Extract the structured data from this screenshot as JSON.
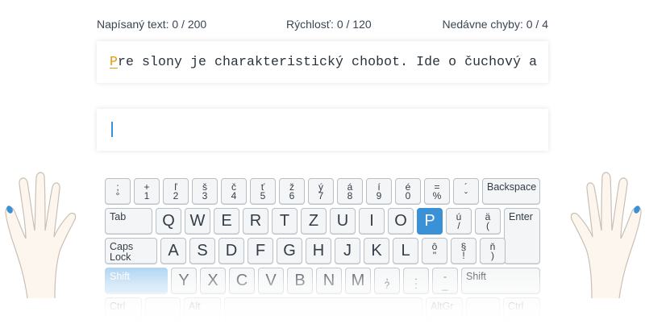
{
  "stats": {
    "typed_text": "Napísaný text: 0 / 200",
    "speed": "Rýchlosť: 0 / 120",
    "recent_errors": "Nedávne chyby: 0 / 4"
  },
  "lesson": {
    "current_char": "P",
    "remaining_text": "re slony je charakteristický chobot. Ide o čuchový a"
  },
  "input": {
    "value": ""
  },
  "keyboard": {
    "row1": [
      {
        "top": ";",
        "bottom": "°"
      },
      {
        "top": "+",
        "bottom": "1"
      },
      {
        "top": "ľ",
        "bottom": "2"
      },
      {
        "top": "š",
        "bottom": "3"
      },
      {
        "top": "č",
        "bottom": "4"
      },
      {
        "top": "ť",
        "bottom": "5"
      },
      {
        "top": "ž",
        "bottom": "6"
      },
      {
        "top": "ý",
        "bottom": "7"
      },
      {
        "top": "á",
        "bottom": "8"
      },
      {
        "top": "í",
        "bottom": "9"
      },
      {
        "top": "é",
        "bottom": "0"
      },
      {
        "top": "=",
        "bottom": "%"
      },
      {
        "top": "´",
        "bottom": "ˇ"
      }
    ],
    "backspace": "Backspace",
    "tab": "Tab",
    "row2_letters": [
      "Q",
      "W",
      "E",
      "R",
      "T",
      "Z",
      "U",
      "I",
      "O",
      "P"
    ],
    "row2_symbols": [
      {
        "top": "ú",
        "bottom": "/"
      },
      {
        "top": "ä",
        "bottom": "("
      }
    ],
    "enter": "Enter",
    "caps_lock": "Caps Lock",
    "row3_letters": [
      "A",
      "S",
      "D",
      "F",
      "G",
      "H",
      "J",
      "K",
      "L"
    ],
    "row3_symbols": [
      {
        "top": "ô",
        "bottom": "\""
      },
      {
        "top": "§",
        "bottom": "!"
      },
      {
        "top": "ň",
        "bottom": ")"
      }
    ],
    "shift": "Shift",
    "row4_letters": [
      "Y",
      "X",
      "C",
      "V",
      "B",
      "N",
      "M"
    ],
    "row4_symbols": [
      {
        "top": ",",
        "bottom": "?"
      },
      {
        "top": ".",
        "bottom": ":"
      },
      {
        "top": "-",
        "bottom": "_"
      }
    ],
    "ctrl": "Ctrl",
    "alt": "Alt",
    "altgr": "AltGr",
    "highlighted_key": "P",
    "highlight_color": "#3a91d6",
    "shift_hint_color": "#a8d0f0"
  },
  "colors": {
    "cursor_char": "#e39a0f",
    "caret": "#3d8fd4",
    "finger_marker": "#3a91d6"
  }
}
